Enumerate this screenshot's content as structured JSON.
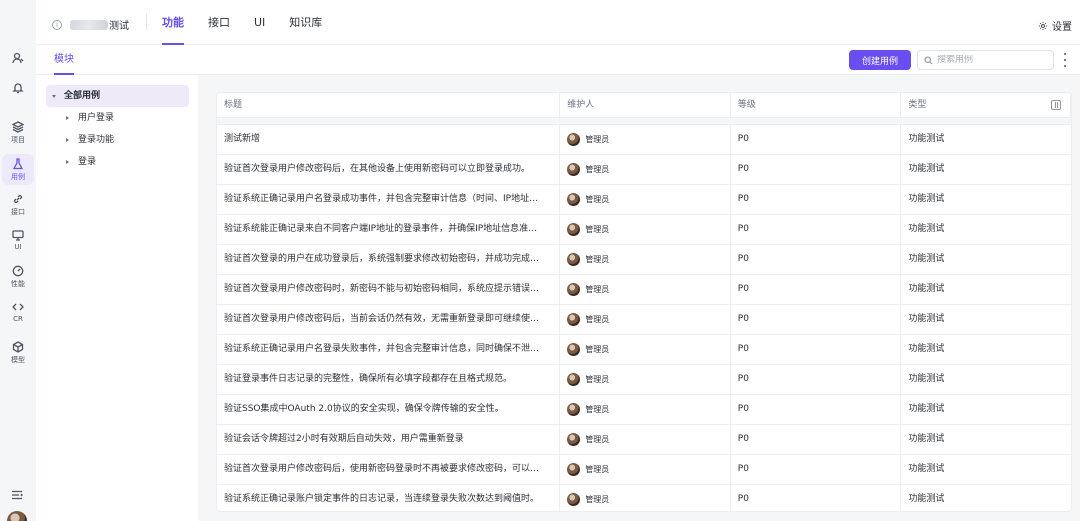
{
  "header": {
    "project_suffix": "测试",
    "tabs": [
      {
        "label": "功能",
        "active": true
      },
      {
        "label": "接口",
        "active": false
      },
      {
        "label": "UI",
        "active": false
      },
      {
        "label": "知识库",
        "active": false
      }
    ],
    "settings_label": "设置"
  },
  "rail": {
    "items": [
      {
        "label": "",
        "icon": "user-icon"
      },
      {
        "label": "",
        "icon": "bell-icon"
      },
      {
        "label": "项目",
        "icon": "layers-icon"
      },
      {
        "label": "用例",
        "icon": "flask-icon",
        "active": true
      },
      {
        "label": "接口",
        "icon": "link-icon"
      },
      {
        "label": "UI",
        "icon": "monitor-icon"
      },
      {
        "label": "性能",
        "icon": "gauge-icon"
      },
      {
        "label": "CR",
        "icon": "code-icon"
      },
      {
        "label": "模型",
        "icon": "cube-icon"
      }
    ]
  },
  "subbar": {
    "module_tab": "模块",
    "create_button": "创建用例",
    "search_placeholder": "搜索用例"
  },
  "tree": {
    "root": "全部用例",
    "children": [
      "用户登录",
      "登录功能",
      "登录"
    ]
  },
  "table": {
    "columns": [
      "标题",
      "维护人",
      "等级",
      "类型"
    ],
    "rows": [
      {
        "title": "测试新增",
        "owner": "管理员",
        "level": "P0",
        "type": "功能测试"
      },
      {
        "title": "验证首次登录用户修改密码后，在其他设备上使用新密码可以立即登录成功。",
        "owner": "管理员",
        "level": "P0",
        "type": "功能测试"
      },
      {
        "title": "验证系统正确记录用户名登录成功事件，并包含完整审计信息（时间、IP地址、登...",
        "owner": "管理员",
        "level": "P0",
        "type": "功能测试"
      },
      {
        "title": "验证系统能正确记录来自不同客户端IP地址的登录事件，并确保IP地址信息准确无...",
        "owner": "管理员",
        "level": "P0",
        "type": "功能测试"
      },
      {
        "title": "验证首次登录的用户在成功登录后，系统强制要求修改初始密码，并成功完成密码...",
        "owner": "管理员",
        "level": "P0",
        "type": "功能测试"
      },
      {
        "title": "验证首次登录用户修改密码时，新密码不能与初始密码相同，系统应提示错误并阻...",
        "owner": "管理员",
        "level": "P0",
        "type": "功能测试"
      },
      {
        "title": "验证首次登录用户修改密码后，当前会话仍然有效，无需重新登录即可继续使用系...",
        "owner": "管理员",
        "level": "P0",
        "type": "功能测试"
      },
      {
        "title": "验证系统正确记录用户名登录失败事件，并包含完整审计信息，同时确保不泄露具...",
        "owner": "管理员",
        "level": "P0",
        "type": "功能测试"
      },
      {
        "title": "验证登录事件日志记录的完整性，确保所有必填字段都存在且格式规范。",
        "owner": "管理员",
        "level": "P0",
        "type": "功能测试"
      },
      {
        "title": "验证SSO集成中OAuth 2.0协议的安全实现，确保令牌传输的安全性。",
        "owner": "管理员",
        "level": "P0",
        "type": "功能测试"
      },
      {
        "title": "验证会话令牌超过2小时有效期后自动失效，用户需重新登录",
        "owner": "管理员",
        "level": "P0",
        "type": "功能测试"
      },
      {
        "title": "验证首次登录用户修改密码后，使用新密码登录时不再被要求修改密码，可以正常...",
        "owner": "管理员",
        "level": "P0",
        "type": "功能测试"
      },
      {
        "title": "验证系统正确记录账户锁定事件的日志记录，当连续登录失败次数达到阈值时。",
        "owner": "管理员",
        "level": "P0",
        "type": "功能测试"
      }
    ]
  },
  "colors": {
    "accent": "#6b4ef0",
    "accent_soft": "#ece9fd",
    "border": "#eceef2",
    "background": "#f5f6f8"
  }
}
